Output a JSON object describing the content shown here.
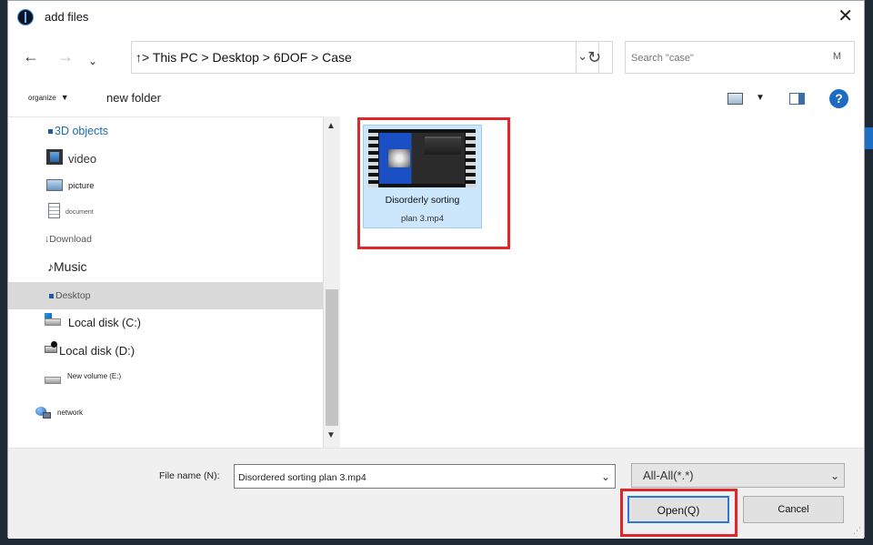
{
  "window": {
    "title": "add files",
    "close": "✕"
  },
  "nav": {
    "back": "←",
    "forward": "→",
    "recent": "⌄"
  },
  "address": {
    "path": "↑> This PC > Desktop > 6DOF > Case",
    "dropdown": "⌄",
    "refresh": "↻"
  },
  "search": {
    "placeholder": "Search \"case\"",
    "trailing": "M"
  },
  "toolbar": {
    "organize": "organize",
    "organize_arrow": "▼",
    "new_folder": "new folder",
    "view_arrow": "▼",
    "help": "?"
  },
  "sidebar": {
    "items": [
      {
        "label": "3D objects",
        "icon": "cube-icon"
      },
      {
        "label": "video",
        "icon": "video-icon"
      },
      {
        "label": "picture",
        "icon": "picture-icon"
      },
      {
        "label": "document",
        "icon": "document-icon"
      },
      {
        "label": "↓Download",
        "icon": "download-icon"
      },
      {
        "label": "♪Music",
        "icon": "music-icon"
      },
      {
        "label": "Desktop",
        "icon": "desktop-icon",
        "selected": true
      },
      {
        "label": "Local disk (C:)",
        "icon": "drive-icon"
      },
      {
        "label": "Local disk (D:)",
        "icon": "drive-icon"
      },
      {
        "label": "New volume (E:)",
        "icon": "drive-icon"
      },
      {
        "label": "network",
        "icon": "network-icon"
      }
    ]
  },
  "scrollbar": {
    "up": "▲",
    "down": "▼"
  },
  "files": [
    {
      "name_line1": "Disorderly sorting",
      "name_line2": "plan 3.mp4",
      "selected": true
    }
  ],
  "footer": {
    "file_name_label": "File name (N):",
    "file_name_value": "Disordered sorting plan 3.mp4",
    "file_name_arrow": "⌄",
    "filter_value": "All-All(*.*)",
    "filter_arrow": "⌄",
    "open_label": "Open(Q)",
    "cancel_label": "Cancel",
    "grip": "⋰"
  },
  "colors": {
    "accent": "#1e6bc4",
    "selection": "#cce6fb",
    "highlight": "#e0262b"
  }
}
